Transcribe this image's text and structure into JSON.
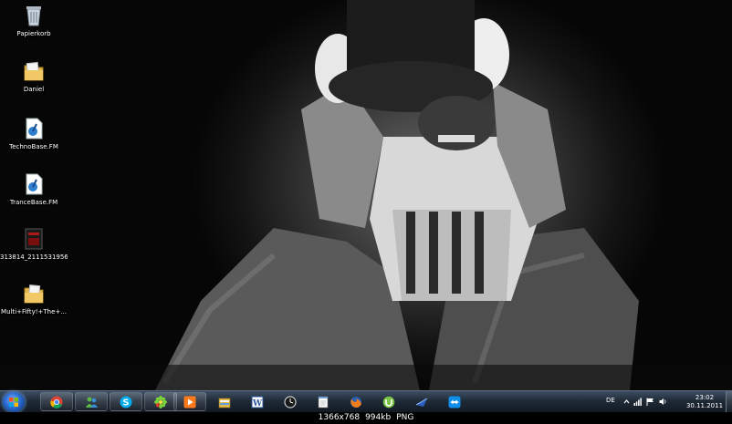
{
  "desktop": {
    "icons": [
      {
        "label": "Papierkorb",
        "icon": "recycle-bin-icon"
      },
      {
        "label": "Daniel",
        "icon": "user-folder-icon"
      },
      {
        "label": "TechnoBase.FM",
        "icon": "audio-file-icon"
      },
      {
        "label": "TranceBase.FM",
        "icon": "audio-file-icon"
      },
      {
        "label": "313814_21115319561...",
        "icon": "image-file-icon"
      },
      {
        "label": "Multi+Fifty!+The+...",
        "icon": "folder-icon"
      }
    ]
  },
  "taskbar": {
    "pinned": [
      "chrome-icon",
      "messenger-icon",
      "skype-icon",
      "icq-icon",
      "media-player-icon",
      "explorer-icon",
      "word-icon",
      "clock-gadget-icon",
      "notepad-icon",
      "firefox-icon",
      "utorrent-icon",
      "sharpreader-icon",
      "teamviewer-icon"
    ],
    "tray": {
      "language": "DE",
      "time": "23:02",
      "date": "30.11.2011"
    }
  },
  "caption": {
    "resolution": "1366x768",
    "size": "994kb",
    "format": "PNG"
  }
}
